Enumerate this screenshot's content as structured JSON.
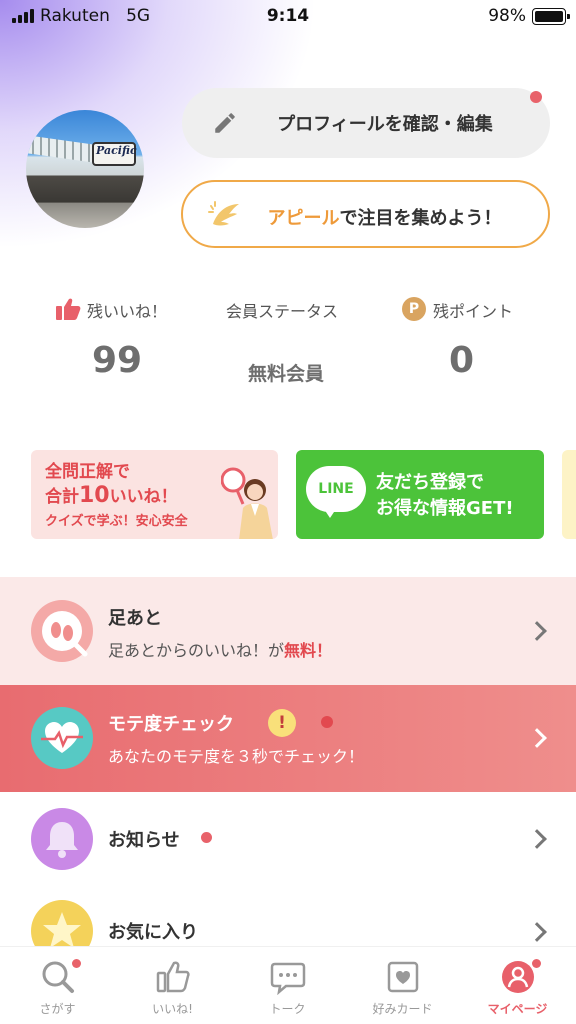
{
  "status_bar": {
    "carrier": "Rakuten",
    "network": "5G",
    "time": "9:14",
    "battery": "98%"
  },
  "profile": {
    "avatar_alt": "Pacific",
    "edit_button": "プロフィールを確認・編集",
    "appeal_button_highlight": "アピール",
    "appeal_button_rest": "で注目を集めよう！"
  },
  "stats": {
    "likes_label": "残いいね！",
    "likes_value": "99",
    "status_label": "会員ステータス",
    "status_value": "無料会員",
    "points_icon": "P",
    "points_label": "残ポイント",
    "points_value": "0"
  },
  "banners": {
    "quiz_line1": "全問正解で",
    "quiz_line2_a": "合計",
    "quiz_line2_num": "10",
    "quiz_line2_b": "いいね！",
    "quiz_sub": "クイズで学ぶ！安心安全",
    "line_logo": "LINE",
    "line_line1": "友だち登録で",
    "line_line2": "お得な情報GET!"
  },
  "menu": {
    "ashiato_title": "足あと",
    "ashiato_sub_a": "足あとからのいいね！が",
    "ashiato_sub_b": "無料！",
    "mote_title": "モテ度チェック",
    "mote_warn": "!",
    "mote_sub": "あなたのモテ度を３秒でチェック！",
    "news_title": "お知らせ",
    "fav_title": "お気に入り"
  },
  "tabs": [
    {
      "label": "さがす",
      "icon": "search-icon"
    },
    {
      "label": "いいね!",
      "icon": "thumbs-up-icon"
    },
    {
      "label": "トーク",
      "icon": "chat-icon"
    },
    {
      "label": "好みカード",
      "icon": "card-icon"
    },
    {
      "label": "マイページ",
      "icon": "person-icon"
    }
  ],
  "colors": {
    "accent": "#e8606a",
    "appeal": "#f0a948",
    "line_green": "#4cc33a"
  }
}
